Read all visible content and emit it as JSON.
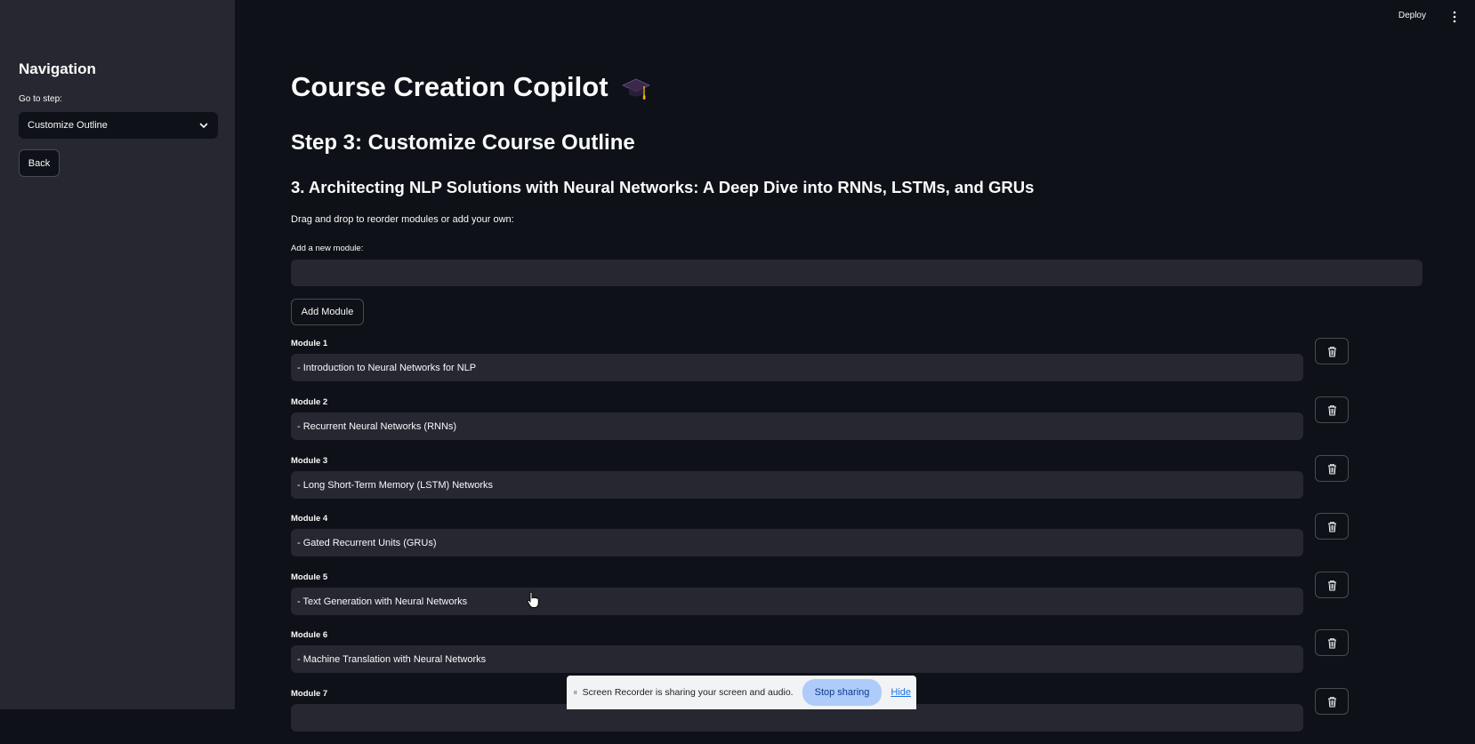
{
  "sidebar": {
    "title": "Navigation",
    "step_label": "Go to step:",
    "selected_step": "Customize Outline",
    "back_label": "Back"
  },
  "header": {
    "deploy_label": "Deploy"
  },
  "main": {
    "title": "Course Creation Copilot",
    "title_emoji": "graduation-cap-icon",
    "step_title": "Step 3: Customize Course Outline",
    "course_title": "3. Architecting NLP Solutions with Neural Networks: A Deep Dive into RNNs, LSTMs, and GRUs",
    "instructions": "Drag and drop to reorder modules or add your own:",
    "add_module_label": "Add a new module:",
    "add_module_value": "",
    "add_module_button": "Add Module",
    "modules": [
      {
        "label": "Module 1",
        "value": "- Introduction to Neural Networks for NLP"
      },
      {
        "label": "Module 2",
        "value": "- Recurrent Neural Networks (RNNs)"
      },
      {
        "label": "Module 3",
        "value": "- Long Short-Term Memory (LSTM) Networks"
      },
      {
        "label": "Module 4",
        "value": "- Gated Recurrent Units (GRUs)"
      },
      {
        "label": "Module 5",
        "value": "- Text Generation with Neural Networks"
      },
      {
        "label": "Module 6",
        "value": "- Machine Translation with Neural Networks"
      },
      {
        "label": "Module 7",
        "value": ""
      }
    ]
  },
  "share_bar": {
    "message": "Screen Recorder is sharing your screen and audio.",
    "stop_label": "Stop sharing",
    "hide_label": "Hide"
  },
  "colors": {
    "background": "#0e1117",
    "sidebar": "#262730",
    "input": "#262730",
    "stop_button": "#aecbfa",
    "link": "#1a73e8"
  }
}
